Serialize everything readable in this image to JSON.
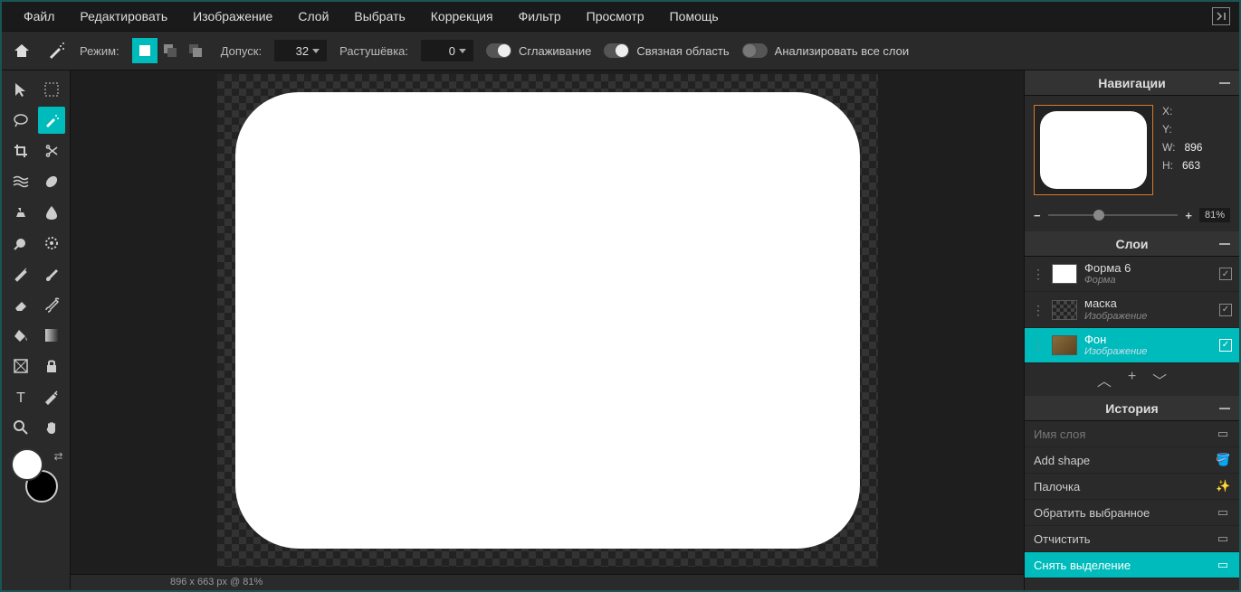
{
  "menu": [
    "Файл",
    "Редактировать",
    "Изображение",
    "Слой",
    "Выбрать",
    "Коррекция",
    "Фильтр",
    "Просмотр",
    "Помощь"
  ],
  "optionbar": {
    "mode_label": "Режим:",
    "tolerance_label": "Допуск:",
    "tolerance_value": "32",
    "feather_label": "Растушёвка:",
    "feather_value": "0",
    "antialias": "Сглаживание",
    "contiguous": "Связная область",
    "all_layers": "Анализировать все слои"
  },
  "nav": {
    "title": "Навигации",
    "x_label": "X:",
    "y_label": "Y:",
    "w_label": "W:",
    "h_label": "H:",
    "w_value": "896",
    "h_value": "663",
    "zoom": "81%"
  },
  "layers_panel": {
    "title": "Слои",
    "items": [
      {
        "name": "Форма 6",
        "type": "Форма",
        "selected": false,
        "thumb": "white"
      },
      {
        "name": "маска",
        "type": "Изображение",
        "selected": false,
        "thumb": "checker"
      },
      {
        "name": "Фон",
        "type": "Изображение",
        "selected": true,
        "thumb": "img"
      }
    ]
  },
  "history_panel": {
    "title": "История",
    "items": [
      {
        "label": "Имя слоя",
        "icon": "rect",
        "faded": true
      },
      {
        "label": "Add shape",
        "icon": "bucket"
      },
      {
        "label": "Палочка",
        "icon": "wand"
      },
      {
        "label": "Обратить выбранное",
        "icon": "dashed"
      },
      {
        "label": "Отчистить",
        "icon": "rect"
      },
      {
        "label": "Снять выделение",
        "icon": "dashed",
        "selected": true
      }
    ]
  },
  "status": "896 x 663 px @ 81%",
  "chart_data": null
}
